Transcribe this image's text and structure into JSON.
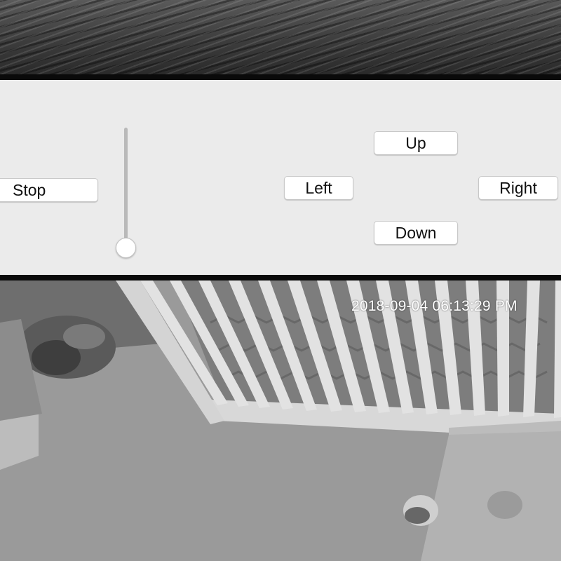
{
  "controls": {
    "stop_label": "Stop",
    "up_label": "Up",
    "down_label": "Down",
    "left_label": "Left",
    "right_label": "Right"
  },
  "zoom_slider": {
    "level": 0.0
  },
  "camera_feed": {
    "timestamp": "2018-09-04 06:13:29 PM"
  },
  "colors": {
    "panel_background": "#ebebeb",
    "divider": "#0a0a0a",
    "button_background": "#ffffff"
  }
}
